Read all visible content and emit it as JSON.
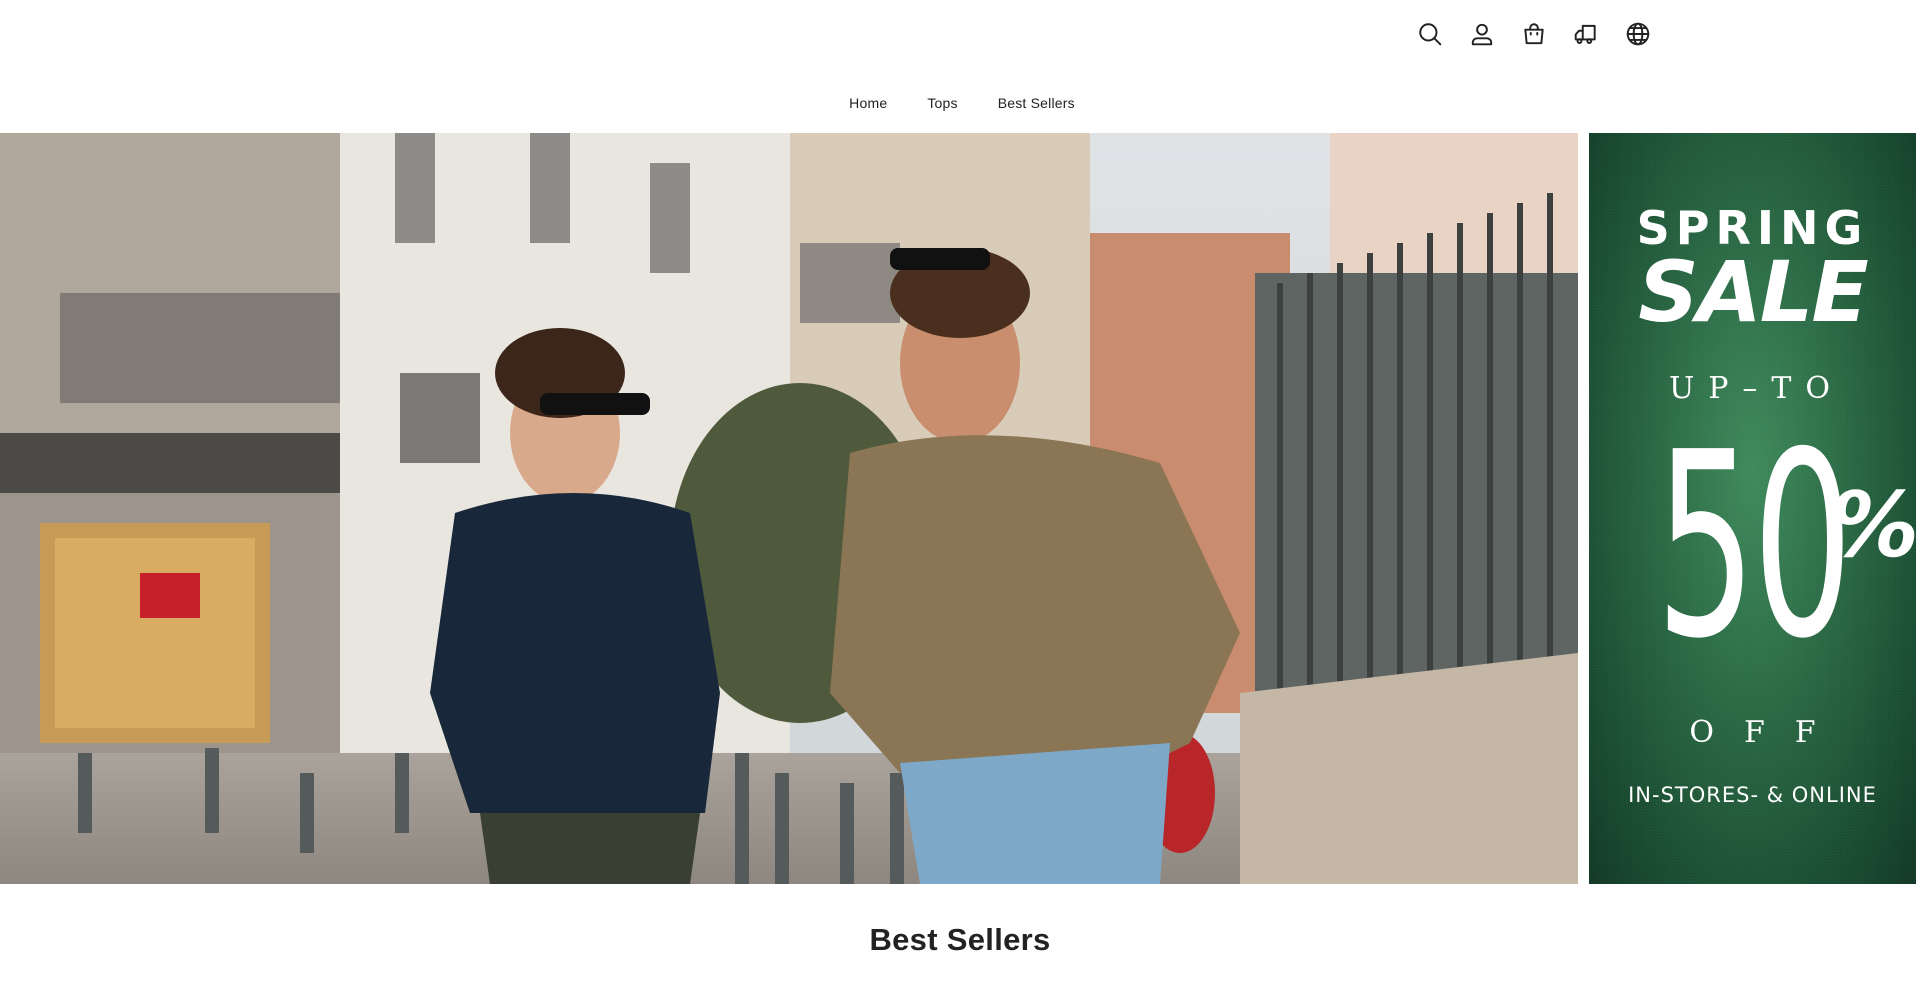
{
  "header": {
    "icons": [
      "search-icon",
      "account-icon",
      "shopping-bag-icon",
      "delivery-truck-icon",
      "globe-icon"
    ]
  },
  "nav": {
    "items": [
      {
        "label": "Home"
      },
      {
        "label": "Tops"
      },
      {
        "label": "Best Sellers"
      }
    ]
  },
  "promo": {
    "line1": "SPRING",
    "line2": "SALE",
    "line3": "UP–TO",
    "number": "50",
    "percent": "%",
    "line4": "OFF",
    "line5": "IN-STORES- & ONLINE",
    "background_color": "#2b6a45"
  },
  "section": {
    "title": "Best Sellers"
  }
}
